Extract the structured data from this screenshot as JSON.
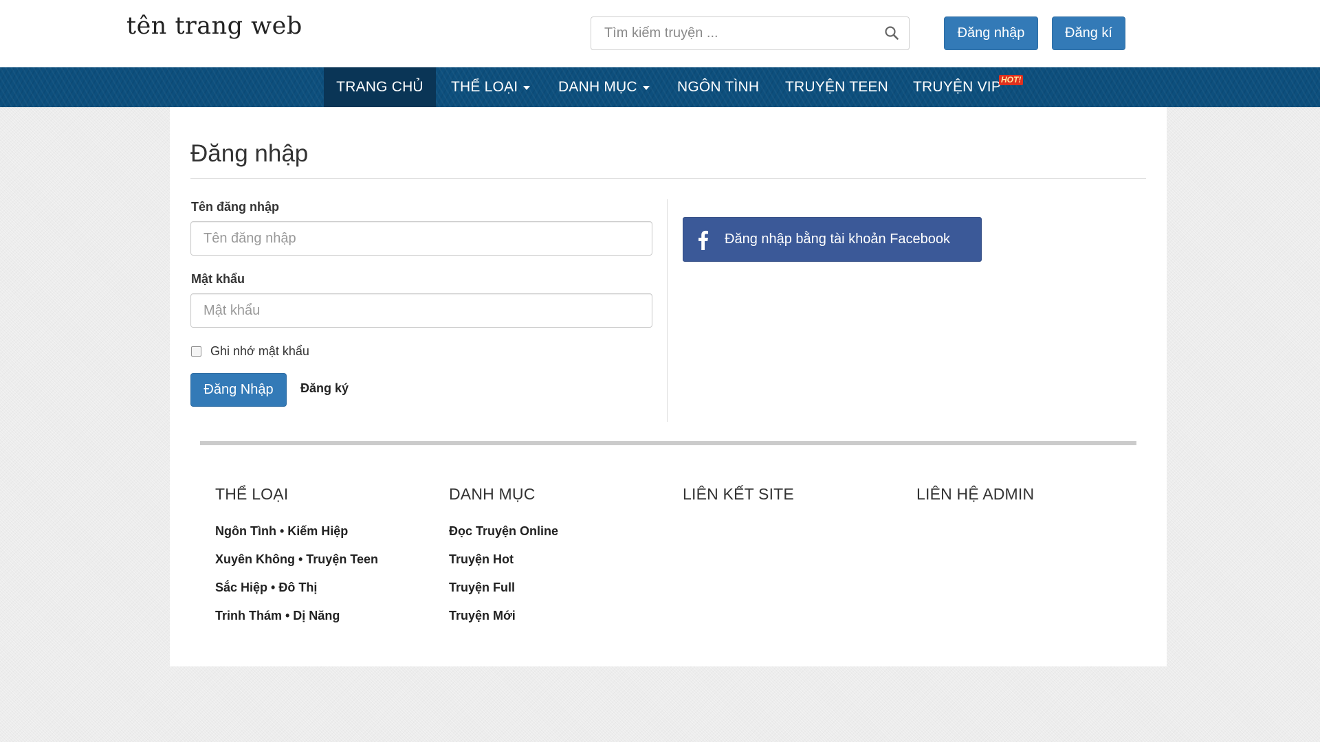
{
  "header": {
    "site_title": "tên trang web",
    "search_placeholder": "Tìm kiếm truyện ...",
    "login_label": "Đăng nhập",
    "register_label": "Đăng kí"
  },
  "nav": {
    "items": [
      {
        "label": "TRANG CHỦ",
        "active": true
      },
      {
        "label": "THỂ LOẠI",
        "dropdown": true
      },
      {
        "label": "DANH MỤC",
        "dropdown": true
      },
      {
        "label": "NGÔN TÌNH"
      },
      {
        "label": "TRUYỆN TEEN"
      },
      {
        "label": "TRUYỆN VIP"
      }
    ],
    "hot_badge": "HOT!"
  },
  "login": {
    "title": "Đăng nhập",
    "username_label": "Tên đăng nhập",
    "username_placeholder": "Tên đăng nhập",
    "password_label": "Mật khẩu",
    "password_placeholder": "Mật khẩu",
    "remember_label": "Ghi nhớ mật khẩu",
    "remember_checked": false,
    "submit_label": "Đăng Nhập",
    "register_link": "Đăng ký",
    "facebook_label": "Đăng nhập bằng tài khoản Facebook"
  },
  "footer": {
    "columns": [
      {
        "heading": "THỂ LOẠI",
        "links": [
          "Ngôn Tình • Kiếm Hiệp",
          "Xuyên Không • Truyện Teen",
          "Sắc Hiệp • Đô Thị",
          "Trinh Thám • Dị Năng"
        ]
      },
      {
        "heading": "DANH MỤC",
        "links": [
          "Đọc Truyện Online",
          "Truyện Hot",
          "Truyện Full",
          "Truyện Mới"
        ]
      },
      {
        "heading": "LIÊN KẾT SITE",
        "links": []
      },
      {
        "heading": "LIÊN HỆ ADMIN",
        "links": []
      }
    ]
  },
  "colors": {
    "primary": "#337ab7",
    "navbar": "#0d4f7d",
    "navbar_active": "#0a3556",
    "facebook": "#3b5998",
    "hot": "#e0301e"
  }
}
